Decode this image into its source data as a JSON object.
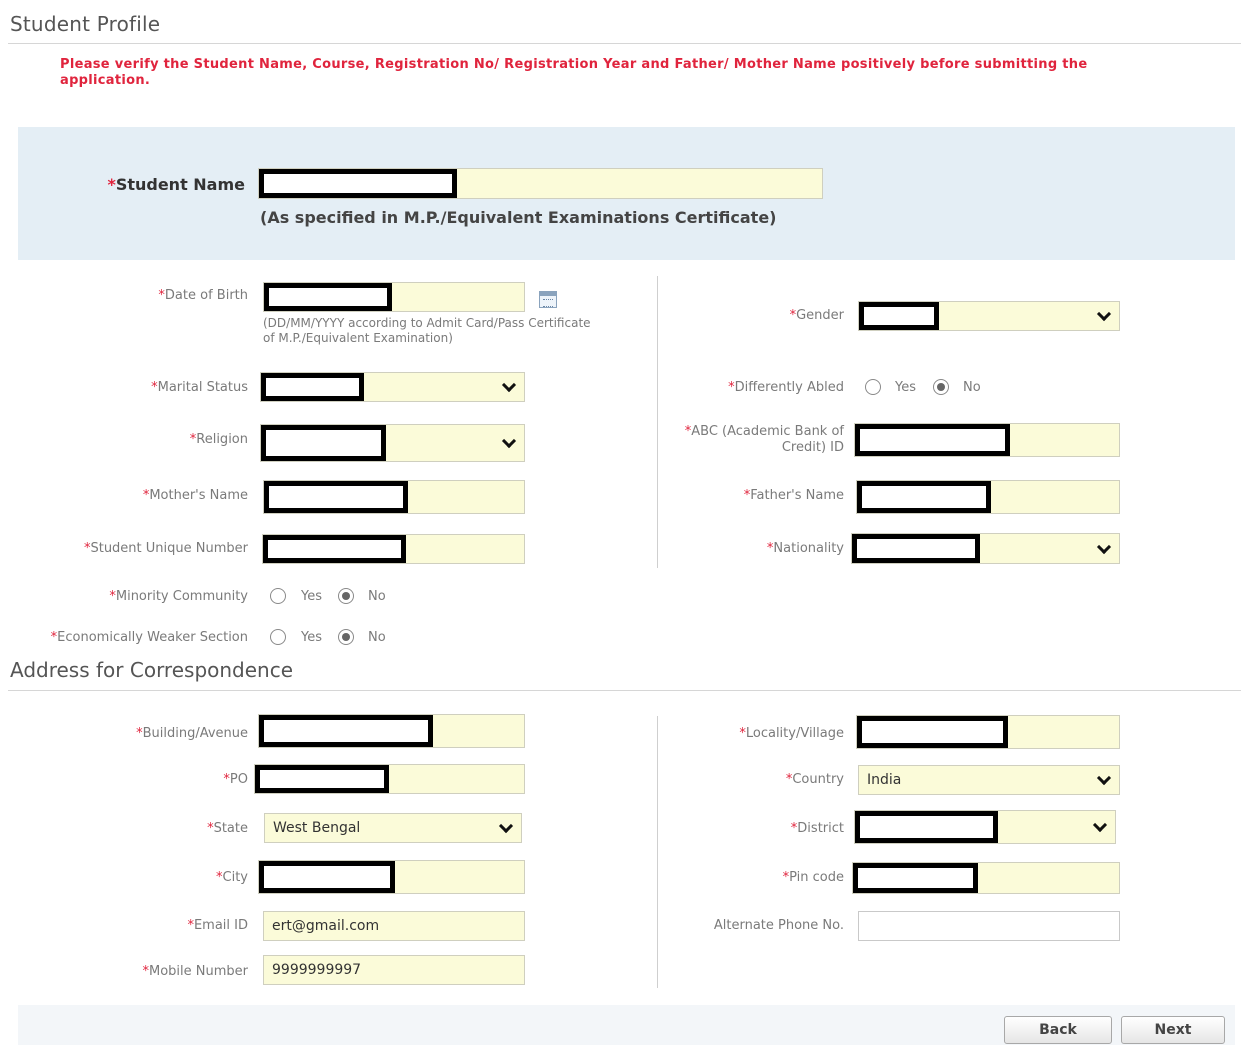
{
  "page_title": "Student Profile",
  "notice": "Please verify the Student Name, Course, Registration No/ Registration Year and Father/ Mother Name positively before submitting the application.",
  "required_mark": "*",
  "student_name": {
    "label": "Student Name",
    "hint": "(As specified in M.P./Equivalent Examinations Certificate)"
  },
  "personal": {
    "dob": {
      "label": "Date of Birth",
      "hint": "(DD/MM/YYYY according to Admit Card/Pass Certificate of M.P./Equivalent Examination)",
      "calendar_icon": "calendar-icon"
    },
    "gender": {
      "label": "Gender"
    },
    "marital_status": {
      "label": "Marital Status"
    },
    "differently_abled": {
      "label": "Differently Abled",
      "yes": "Yes",
      "no": "No",
      "selected": "No"
    },
    "religion": {
      "label": "Religion"
    },
    "abc_id": {
      "label": "ABC (Academic Bank of Credit) ID"
    },
    "mothers_name": {
      "label": "Mother's Name"
    },
    "fathers_name": {
      "label": "Father's Name"
    },
    "student_unique_number": {
      "label": "Student Unique Number"
    },
    "nationality": {
      "label": "Nationality"
    },
    "minority_community": {
      "label": "Minority Community",
      "yes": "Yes",
      "no": "No",
      "selected": "No"
    },
    "ews": {
      "label": "Economically Weaker Section",
      "yes": "Yes",
      "no": "No",
      "selected": "No"
    }
  },
  "address": {
    "section_title": "Address for Correspondence",
    "building": {
      "label": "Building/Avenue"
    },
    "locality": {
      "label": "Locality/Village"
    },
    "po": {
      "label": "PO"
    },
    "country": {
      "label": "Country",
      "value": "India"
    },
    "state": {
      "label": "State",
      "value": "West Bengal"
    },
    "district": {
      "label": "District"
    },
    "city": {
      "label": "City"
    },
    "pin_code": {
      "label": "Pin code"
    },
    "email": {
      "label": "Email ID",
      "value": "ert@gmail.com"
    },
    "alt_phone": {
      "label": "Alternate Phone No.",
      "value": ""
    },
    "mobile": {
      "label": "Mobile Number",
      "value": "9999999997"
    }
  },
  "buttons": {
    "back": "Back",
    "next": "Next"
  }
}
